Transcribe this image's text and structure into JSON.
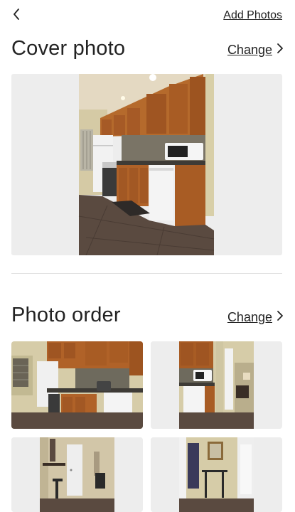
{
  "header": {
    "back_icon": "chevron-left-icon",
    "add_photos_label": "Add Photos"
  },
  "cover": {
    "title": "Cover photo",
    "change_label": "Change",
    "change_icon": "chevron-right-icon",
    "photo": "kitchen-full-view"
  },
  "order": {
    "title": "Photo order",
    "change_label": "Change",
    "change_icon": "chevron-right-icon",
    "photos": [
      "kitchen-counter",
      "kitchen-hallway",
      "hallway-shelf",
      "entryway-mirror"
    ]
  },
  "colors": {
    "text": "#222222",
    "placeholder_bg": "#ededed",
    "cabinet_wood": "#a65a26",
    "floor_tile": "#5a4a40",
    "wall": "#d9cfae"
  }
}
